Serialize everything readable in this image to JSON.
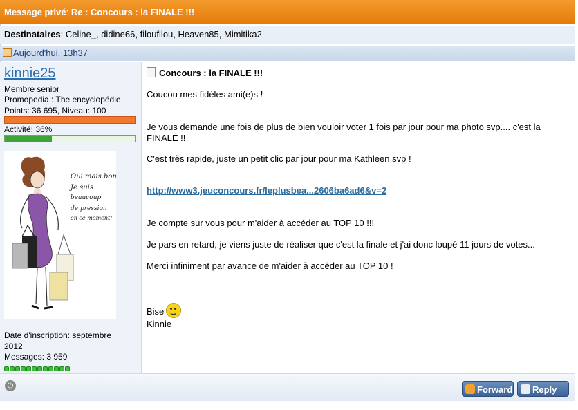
{
  "title": {
    "prefix": "Message privé",
    "sep": ": ",
    "subject": "Re : Concours : la FINALE !!!"
  },
  "recipients": {
    "label": "Destinataires",
    "sep": ": ",
    "names": "Celine_, didine66, filoufilou, Heaven85, Mimitika2"
  },
  "date": "Aujourd'hui, 13h37",
  "author": {
    "name": "kinnie25",
    "rank": "Membre senior",
    "promopedia": "Promopedia : The encyclopédie",
    "points": "Points: 36 695, Niveau: 100",
    "activity": "Activité: 36%",
    "activity_level": 0.36,
    "avatar_text": [
      "Oui mais bon!",
      "Je suis",
      "beaucoup",
      "de pression",
      "en ce moment!"
    ],
    "joined_line1": "Date d'inscription: septembre",
    "joined_line2": "2012",
    "messages": "Messages: 3 959"
  },
  "message": {
    "title": "Concours : la FINALE !!!",
    "lines": [
      "Coucou mes fidèles ami(e)s !",
      "Je vous demande une fois de plus de bien vouloir voter 1 fois par jour pour ma photo svp.... c'est la",
      "FINALE !!",
      "C'est très rapide, juste un petit clic par jour pour ma Kathleen svp !",
      "Je compte sur vous pour m'aider à accéder au TOP 10 !!!",
      "Je pars en retard, je viens juste de réaliser que c'est la finale et j'ai donc loupé 11 jours de votes...",
      "Merci infiniment par avance de m'aider à accéder au TOP 10 !",
      "Bise",
      "Kinnie"
    ],
    "link": "http://www3.jeuconcours.fr/leplusbea...2606ba6ad6&v=2"
  },
  "buttons": {
    "forward": "Forward",
    "reply": "Reply"
  },
  "colors": {
    "title_bar": "#e98a1c",
    "link": "#2a6c9e",
    "username": "#2a6fb0",
    "progress": "#3ea33a"
  }
}
